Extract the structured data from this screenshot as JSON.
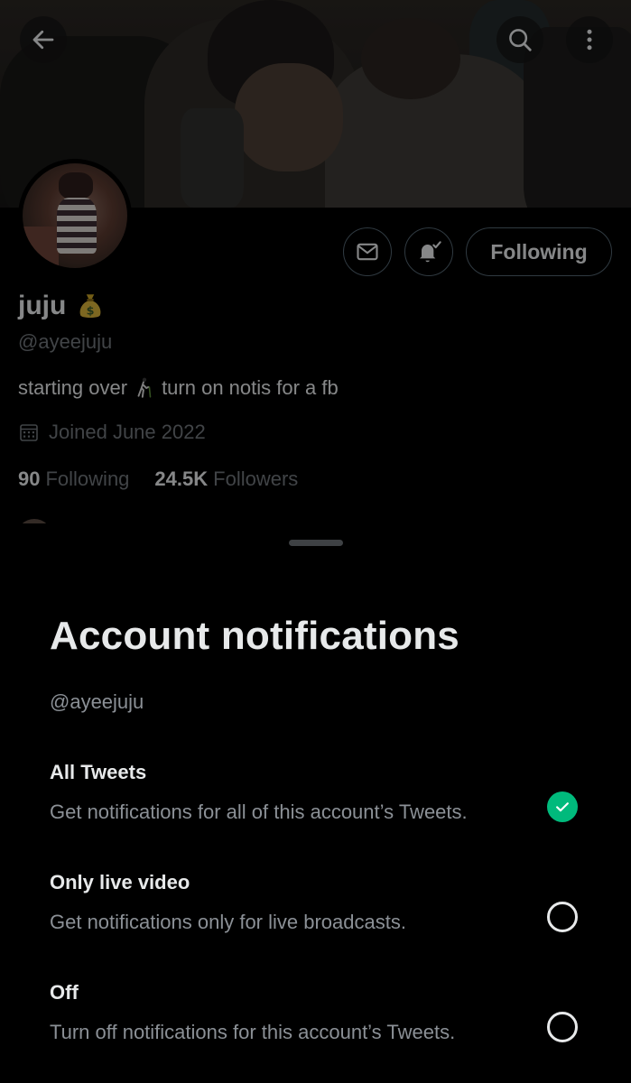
{
  "profile": {
    "display_name": "juju",
    "name_emoji": "money-bag-icon",
    "handle": "@ayeejuju",
    "bio_start": "starting over",
    "bio_end": "turn on notis for a fb",
    "bio_emoji": "person-walking-with-cane-icon",
    "joined": "Joined June 2022",
    "following_count": "90",
    "following_label": "Following",
    "followers_count": "24.5K",
    "followers_label": "Followers",
    "follow_button_label": "Following"
  },
  "sheet": {
    "title": "Account notifications",
    "handle": "@ayeejuju",
    "options": [
      {
        "title": "All Tweets",
        "description": "Get notifications for all of this account’s Tweets.",
        "selected": true
      },
      {
        "title": "Only live video",
        "description": "Get notifications only for live broadcasts.",
        "selected": false
      },
      {
        "title": "Off",
        "description": "Turn off notifications for this account’s Tweets.",
        "selected": false
      }
    ]
  },
  "colors": {
    "background": "#000000",
    "primary_text": "#e7e9ea",
    "secondary_text": "#71767b",
    "border": "#536471",
    "selected_green": "#00ba7c"
  }
}
